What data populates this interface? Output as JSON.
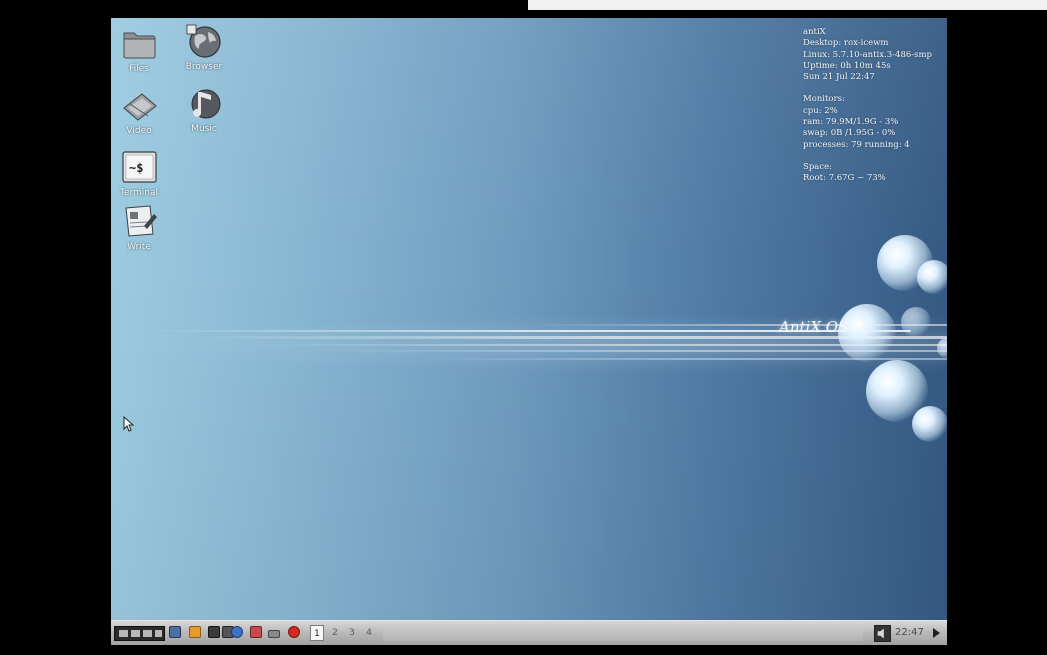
{
  "desktop_icons": [
    {
      "label": "Files",
      "icon": "folder-icon"
    },
    {
      "label": "Browser",
      "icon": "globe-icon"
    },
    {
      "label": "Video",
      "icon": "film-icon"
    },
    {
      "label": "Music",
      "icon": "music-note-icon"
    },
    {
      "label": "Terminal",
      "icon": "terminal-icon"
    },
    {
      "label": "Write",
      "icon": "document-pen-icon"
    }
  ],
  "conky": {
    "lines_top": [
      "antiX",
      "Desktop: rox-icewm",
      "Linux: 5.7.10-antix.3-486-smp",
      "Uptime: 0h 10m 45s",
      "Sun 21 Jul 22:47"
    ],
    "monitors_heading": "Monitors:",
    "monitors": [
      "cpu: 2%",
      "ram: 79.9M/1.9G - 3%",
      "swap: 0B   /1.95G - 0%",
      "processes: 79    running: 4"
    ],
    "space_heading": "Space:",
    "space": [
      "Root: 7.67G ~ 73%"
    ]
  },
  "wallpaper_text": "AntiX OS",
  "taskbar": {
    "workspaces": [
      "1",
      "2",
      "3",
      "4"
    ],
    "active_workspace": "1",
    "clock": "22:47"
  },
  "colors": {
    "taskbar_bg": "#b8b8b8",
    "desktop_left": "#9ccbe0",
    "desktop_right": "#355a84"
  }
}
